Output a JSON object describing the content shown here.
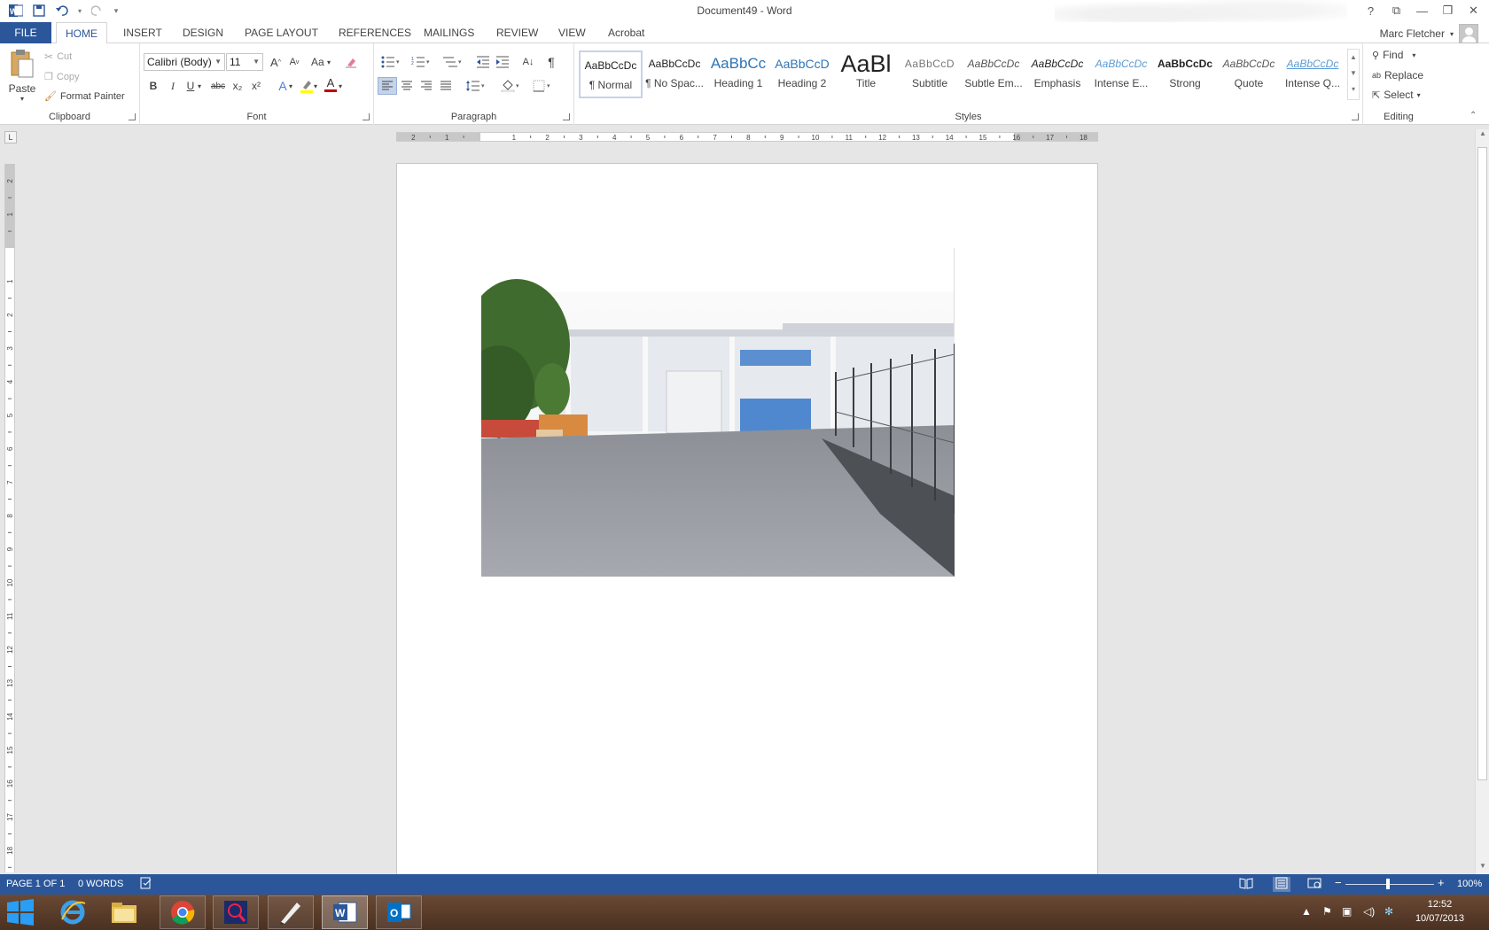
{
  "window": {
    "title": "Document49 - Word",
    "controls": [
      "?",
      "⧉",
      "—",
      "❐",
      "✕"
    ]
  },
  "qat": {
    "save_icon": "save-icon",
    "undo_icon": "undo-icon",
    "redo_icon": "redo-icon"
  },
  "tabs": {
    "file": "FILE",
    "home": "HOME",
    "insert": "INSERT",
    "design": "DESIGN",
    "page_layout": "PAGE LAYOUT",
    "references": "REFERENCES",
    "mailings": "MAILINGS",
    "review": "REVIEW",
    "view": "VIEW",
    "acrobat": "Acrobat"
  },
  "user": {
    "name": "Marc Fletcher"
  },
  "clipboard": {
    "paste": "Paste",
    "cut": "Cut",
    "copy": "Copy",
    "format_painter": "Format Painter",
    "label": "Clipboard"
  },
  "font": {
    "name": "Calibri (Body)",
    "size": "11",
    "label": "Font",
    "change_case": "Aa",
    "bold": "B",
    "italic": "I",
    "underline": "U",
    "strikethrough": "abc",
    "subscript": "x₂",
    "superscript": "x²",
    "grow": "A",
    "shrink": "A",
    "effects": "A",
    "color": "A",
    "color_value": "#c00000",
    "highlight_value": "#ffff00"
  },
  "paragraph": {
    "label": "Paragraph",
    "pilcrow": "¶",
    "sort": "A↓"
  },
  "styles": {
    "label": "Styles",
    "items": [
      {
        "sample": "AaBbCcDc",
        "label": "¶ Normal"
      },
      {
        "sample": "AaBbCcDc",
        "label": "¶ No Spac..."
      },
      {
        "sample": "AaBbCc",
        "label": "Heading 1"
      },
      {
        "sample": "AaBbCcD",
        "label": "Heading 2"
      },
      {
        "sample": "AaBl",
        "label": "Title"
      },
      {
        "sample": "AaBbCcD",
        "label": "Subtitle"
      },
      {
        "sample": "AaBbCcDc",
        "label": "Subtle Em..."
      },
      {
        "sample": "AaBbCcDc",
        "label": "Emphasis"
      },
      {
        "sample": "AaBbCcDc",
        "label": "Intense E..."
      },
      {
        "sample": "AaBbCcDc",
        "label": "Strong"
      },
      {
        "sample": "AaBbCcDc",
        "label": "Quote"
      },
      {
        "sample": "AaBbCcDc",
        "label": "Intense Q..."
      }
    ]
  },
  "editing": {
    "label": "Editing",
    "find": "Find",
    "replace": "Replace",
    "select": "Select"
  },
  "ruler": {
    "h_numbers": [
      "2",
      "1",
      "1",
      "2",
      "3",
      "4",
      "5",
      "6",
      "7",
      "8",
      "9",
      "10",
      "11",
      "12",
      "13",
      "14",
      "15",
      "16",
      "17",
      "18"
    ],
    "v_numbers": [
      "2",
      "1",
      "1",
      "2",
      "3",
      "4",
      "5",
      "6",
      "7",
      "8",
      "9",
      "10",
      "11",
      "12",
      "13",
      "14",
      "15",
      "16",
      "17",
      "18"
    ],
    "corner": "L"
  },
  "status": {
    "page": "PAGE 1 OF 1",
    "words": "0 WORDS",
    "zoom": "100%",
    "zoom_level_percent": 100
  },
  "taskbar": {
    "time": "12:52",
    "date": "10/07/2013",
    "apps": [
      "start",
      "internet-explorer",
      "file-explorer",
      "chrome",
      "search-tool",
      "pen-tool",
      "word",
      "outlook"
    ]
  },
  "colors": {
    "word_blue": "#2b579a",
    "taskbar": "#5a3c2a"
  }
}
